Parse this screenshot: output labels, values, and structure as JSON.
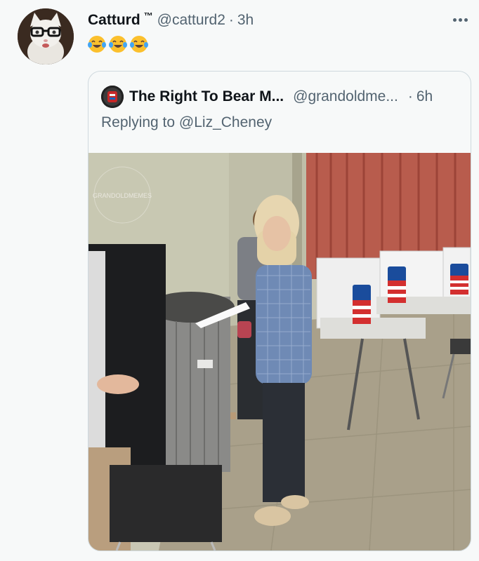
{
  "tweet": {
    "author_name": "Catturd",
    "trademark": "™",
    "handle": "@catturd2",
    "separator": "·",
    "time": "3h",
    "text": "😂😂😂",
    "avatar_icon": "cat-with-glasses-avatar",
    "more_icon": "more-options-icon"
  },
  "quoted": {
    "author_name": "The Right To Bear M...",
    "handle": "@grandoldme...",
    "separator": "·",
    "time": "6h",
    "replying_prefix": "Replying to",
    "replying_to": "@Liz_Cheney",
    "avatar_icon": "grandoldmemes-avatar",
    "photo": {
      "description_icon": "polling-place-photo",
      "watermark_text": "GRANDOLDMEMES"
    }
  },
  "colors": {
    "background": "#f7f9f9",
    "text_primary": "#0f1419",
    "text_secondary": "#536471",
    "border": "#cfd9de"
  }
}
